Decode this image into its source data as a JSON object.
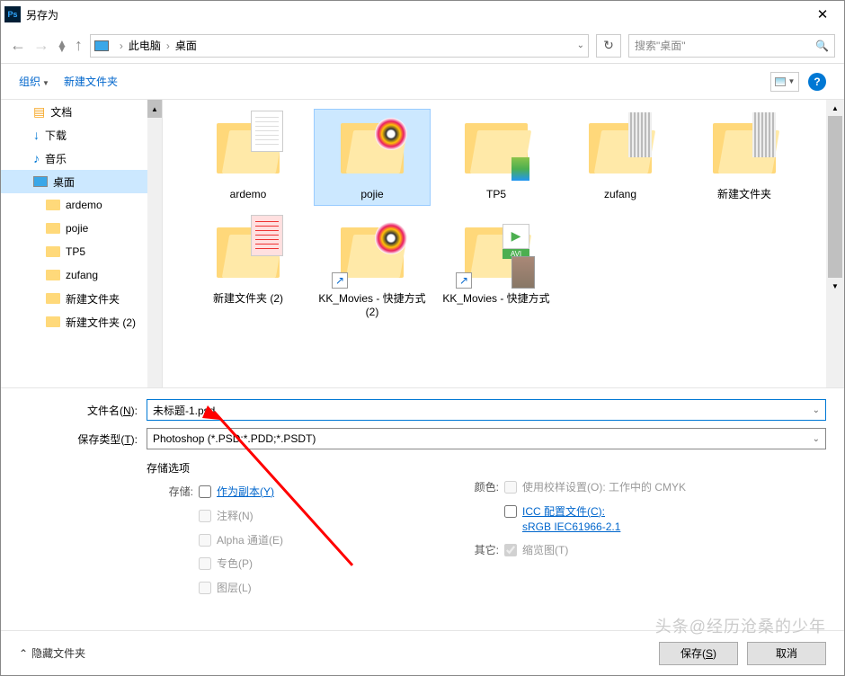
{
  "title": "另存为",
  "breadcrumb": [
    "此电脑",
    "桌面"
  ],
  "search_placeholder": "搜索\"桌面\"",
  "toolbar": {
    "organize": "组织",
    "new_folder": "新建文件夹"
  },
  "sidebar": {
    "items": [
      {
        "label": "文档",
        "kind": "doc"
      },
      {
        "label": "下载",
        "kind": "dl"
      },
      {
        "label": "音乐",
        "kind": "mus"
      },
      {
        "label": "桌面",
        "kind": "desk",
        "selected": true
      },
      {
        "label": "ardemo",
        "kind": "folder",
        "sub": true
      },
      {
        "label": "pojie",
        "kind": "folder",
        "sub": true
      },
      {
        "label": "TP5",
        "kind": "folder",
        "sub": true
      },
      {
        "label": "zufang",
        "kind": "folder",
        "sub": true
      },
      {
        "label": "新建文件夹",
        "kind": "folder",
        "sub": true
      },
      {
        "label": "新建文件夹 (2)",
        "kind": "folder",
        "sub": true
      }
    ]
  },
  "files": [
    {
      "name": "ardemo",
      "icon": "folder-paper-lines"
    },
    {
      "name": "pojie",
      "icon": "folder-cd",
      "selected": true
    },
    {
      "name": "TP5",
      "icon": "folder-thumb"
    },
    {
      "name": "zufang",
      "icon": "folder-strip"
    },
    {
      "name": "新建文件夹",
      "icon": "folder-strip"
    },
    {
      "name": "新建文件夹 (2)",
      "icon": "folder-paper-red"
    },
    {
      "name": "KK_Movies - 快捷方式 (2)",
      "icon": "folder-cd-shortcut"
    },
    {
      "name": "KK_Movies - 快捷方式",
      "icon": "folder-avi-shortcut"
    }
  ],
  "filename_label": "文件名(N):",
  "filename_value": "未标题-1.psd",
  "filetype_label": "保存类型(T):",
  "filetype_value": "Photoshop (*.PSD;*.PDD;*.PSDT)",
  "save_options": {
    "title": "存储选项",
    "store_label": "存储:",
    "as_copy": "作为副本(Y)",
    "notes": "注释(N)",
    "alpha": "Alpha 通道(E)",
    "spot": "专色(P)",
    "layers": "图层(L)",
    "color_label": "颜色:",
    "proof": "使用校样设置(O): 工作中的 CMYK",
    "icc": "ICC 配置文件(C): sRGB IEC61966-2.1",
    "other_label": "其它:",
    "thumb": "缩览图(T)"
  },
  "footer": {
    "hide": "隐藏文件夹",
    "save": "保存(S)",
    "cancel": "取消"
  },
  "watermark": "头条@经历沧桑的少年"
}
